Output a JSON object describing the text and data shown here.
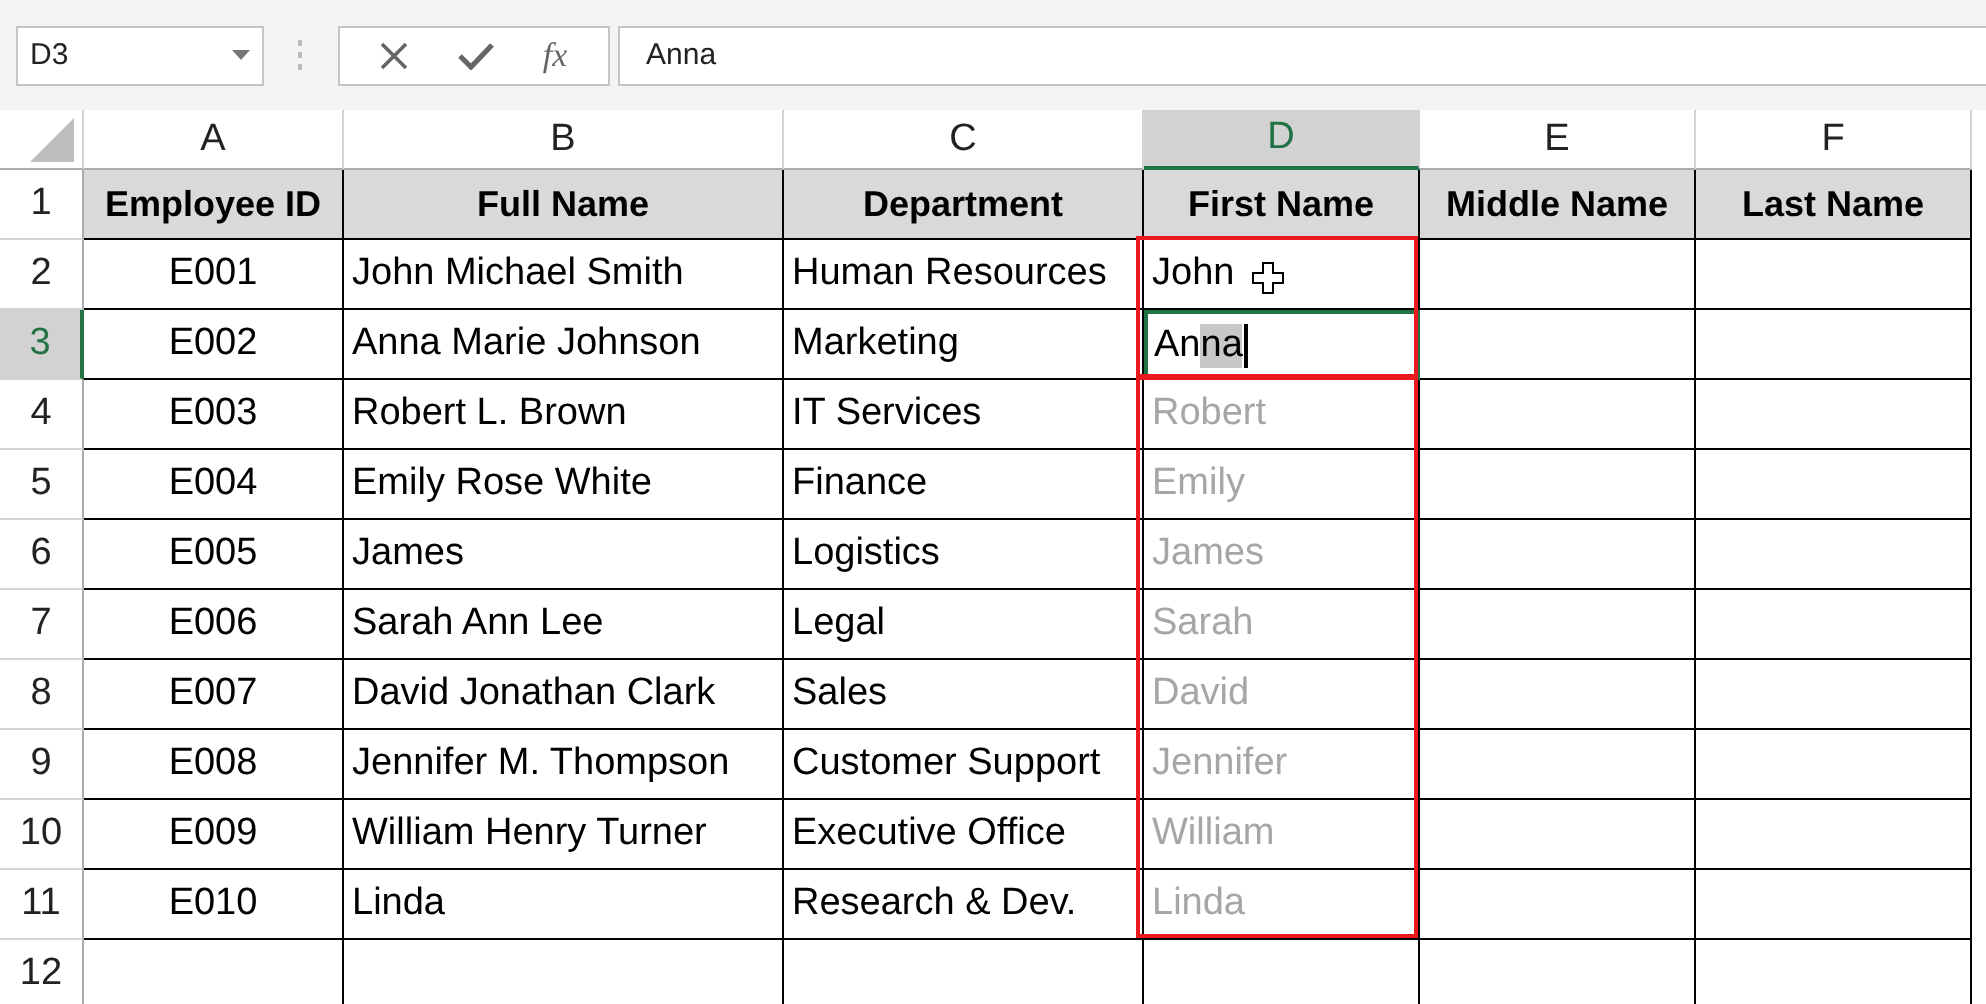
{
  "name_box": {
    "value": "D3"
  },
  "formula_bar": {
    "function_label": "fx",
    "value": "Anna"
  },
  "columns": [
    {
      "label": "A",
      "selected": false
    },
    {
      "label": "B",
      "selected": false
    },
    {
      "label": "C",
      "selected": false
    },
    {
      "label": "D",
      "selected": true
    },
    {
      "label": "E",
      "selected": false
    },
    {
      "label": "F",
      "selected": false
    }
  ],
  "rows": [
    {
      "label": "1",
      "selected": false,
      "kind": "header",
      "cells": [
        {
          "text": "Employee ID"
        },
        {
          "text": "Full Name"
        },
        {
          "text": "Department"
        },
        {
          "text": "First Name"
        },
        {
          "text": "Middle Name"
        },
        {
          "text": "Last Name"
        }
      ]
    },
    {
      "label": "2",
      "selected": false,
      "kind": "data",
      "cells": [
        {
          "text": "E001"
        },
        {
          "text": "John Michael Smith"
        },
        {
          "text": "Human Resources"
        },
        {
          "kind": "typed",
          "text": "John",
          "outlined": true,
          "pointer": true
        }
      ]
    },
    {
      "label": "3",
      "selected": true,
      "kind": "data",
      "cells": [
        {
          "text": "E002"
        },
        {
          "text": "Anna Marie Johnson"
        },
        {
          "text": "Marketing"
        },
        {
          "kind": "editing",
          "outlined": true,
          "parts": [
            {
              "text": "An",
              "selected": false
            },
            {
              "text": "na",
              "selected": true
            }
          ]
        }
      ]
    },
    {
      "label": "4",
      "selected": false,
      "kind": "data",
      "cells": [
        {
          "text": "E003"
        },
        {
          "text": "Robert L. Brown"
        },
        {
          "text": "IT Services"
        },
        {
          "kind": "suggested",
          "text": "Robert",
          "outlined": true
        }
      ]
    },
    {
      "label": "5",
      "selected": false,
      "kind": "data",
      "cells": [
        {
          "text": "E004"
        },
        {
          "text": "Emily Rose White"
        },
        {
          "text": "Finance"
        },
        {
          "kind": "suggested",
          "text": "Emily",
          "outlined": true
        }
      ]
    },
    {
      "label": "6",
      "selected": false,
      "kind": "data",
      "cells": [
        {
          "text": "E005"
        },
        {
          "text": "James"
        },
        {
          "text": "Logistics"
        },
        {
          "kind": "suggested",
          "text": "James",
          "outlined": true
        }
      ]
    },
    {
      "label": "7",
      "selected": false,
      "kind": "data",
      "cells": [
        {
          "text": "E006"
        },
        {
          "text": "Sarah Ann Lee"
        },
        {
          "text": "Legal"
        },
        {
          "kind": "suggested",
          "text": "Sarah",
          "outlined": true
        }
      ]
    },
    {
      "label": "8",
      "selected": false,
      "kind": "data",
      "cells": [
        {
          "text": "E007"
        },
        {
          "text": "David Jonathan Clark"
        },
        {
          "text": "Sales"
        },
        {
          "kind": "suggested",
          "text": "David",
          "outlined": true
        }
      ]
    },
    {
      "label": "9",
      "selected": false,
      "kind": "data",
      "cells": [
        {
          "text": "E008"
        },
        {
          "text": "Jennifer M. Thompson"
        },
        {
          "text": "Customer Support"
        },
        {
          "kind": "suggested",
          "text": "Jennifer",
          "outlined": true
        }
      ]
    },
    {
      "label": "10",
      "selected": false,
      "kind": "data",
      "cells": [
        {
          "text": "E009"
        },
        {
          "text": "William Henry Turner"
        },
        {
          "text": "Executive Office"
        },
        {
          "kind": "suggested",
          "text": "William",
          "outlined": true
        }
      ]
    },
    {
      "label": "11",
      "selected": false,
      "kind": "data",
      "cells": [
        {
          "text": "E010"
        },
        {
          "text": "Linda"
        },
        {
          "text": "Research & Dev."
        },
        {
          "kind": "suggested",
          "text": "Linda",
          "outlined": true
        }
      ]
    },
    {
      "label": "12",
      "selected": false,
      "kind": "data"
    }
  ]
}
